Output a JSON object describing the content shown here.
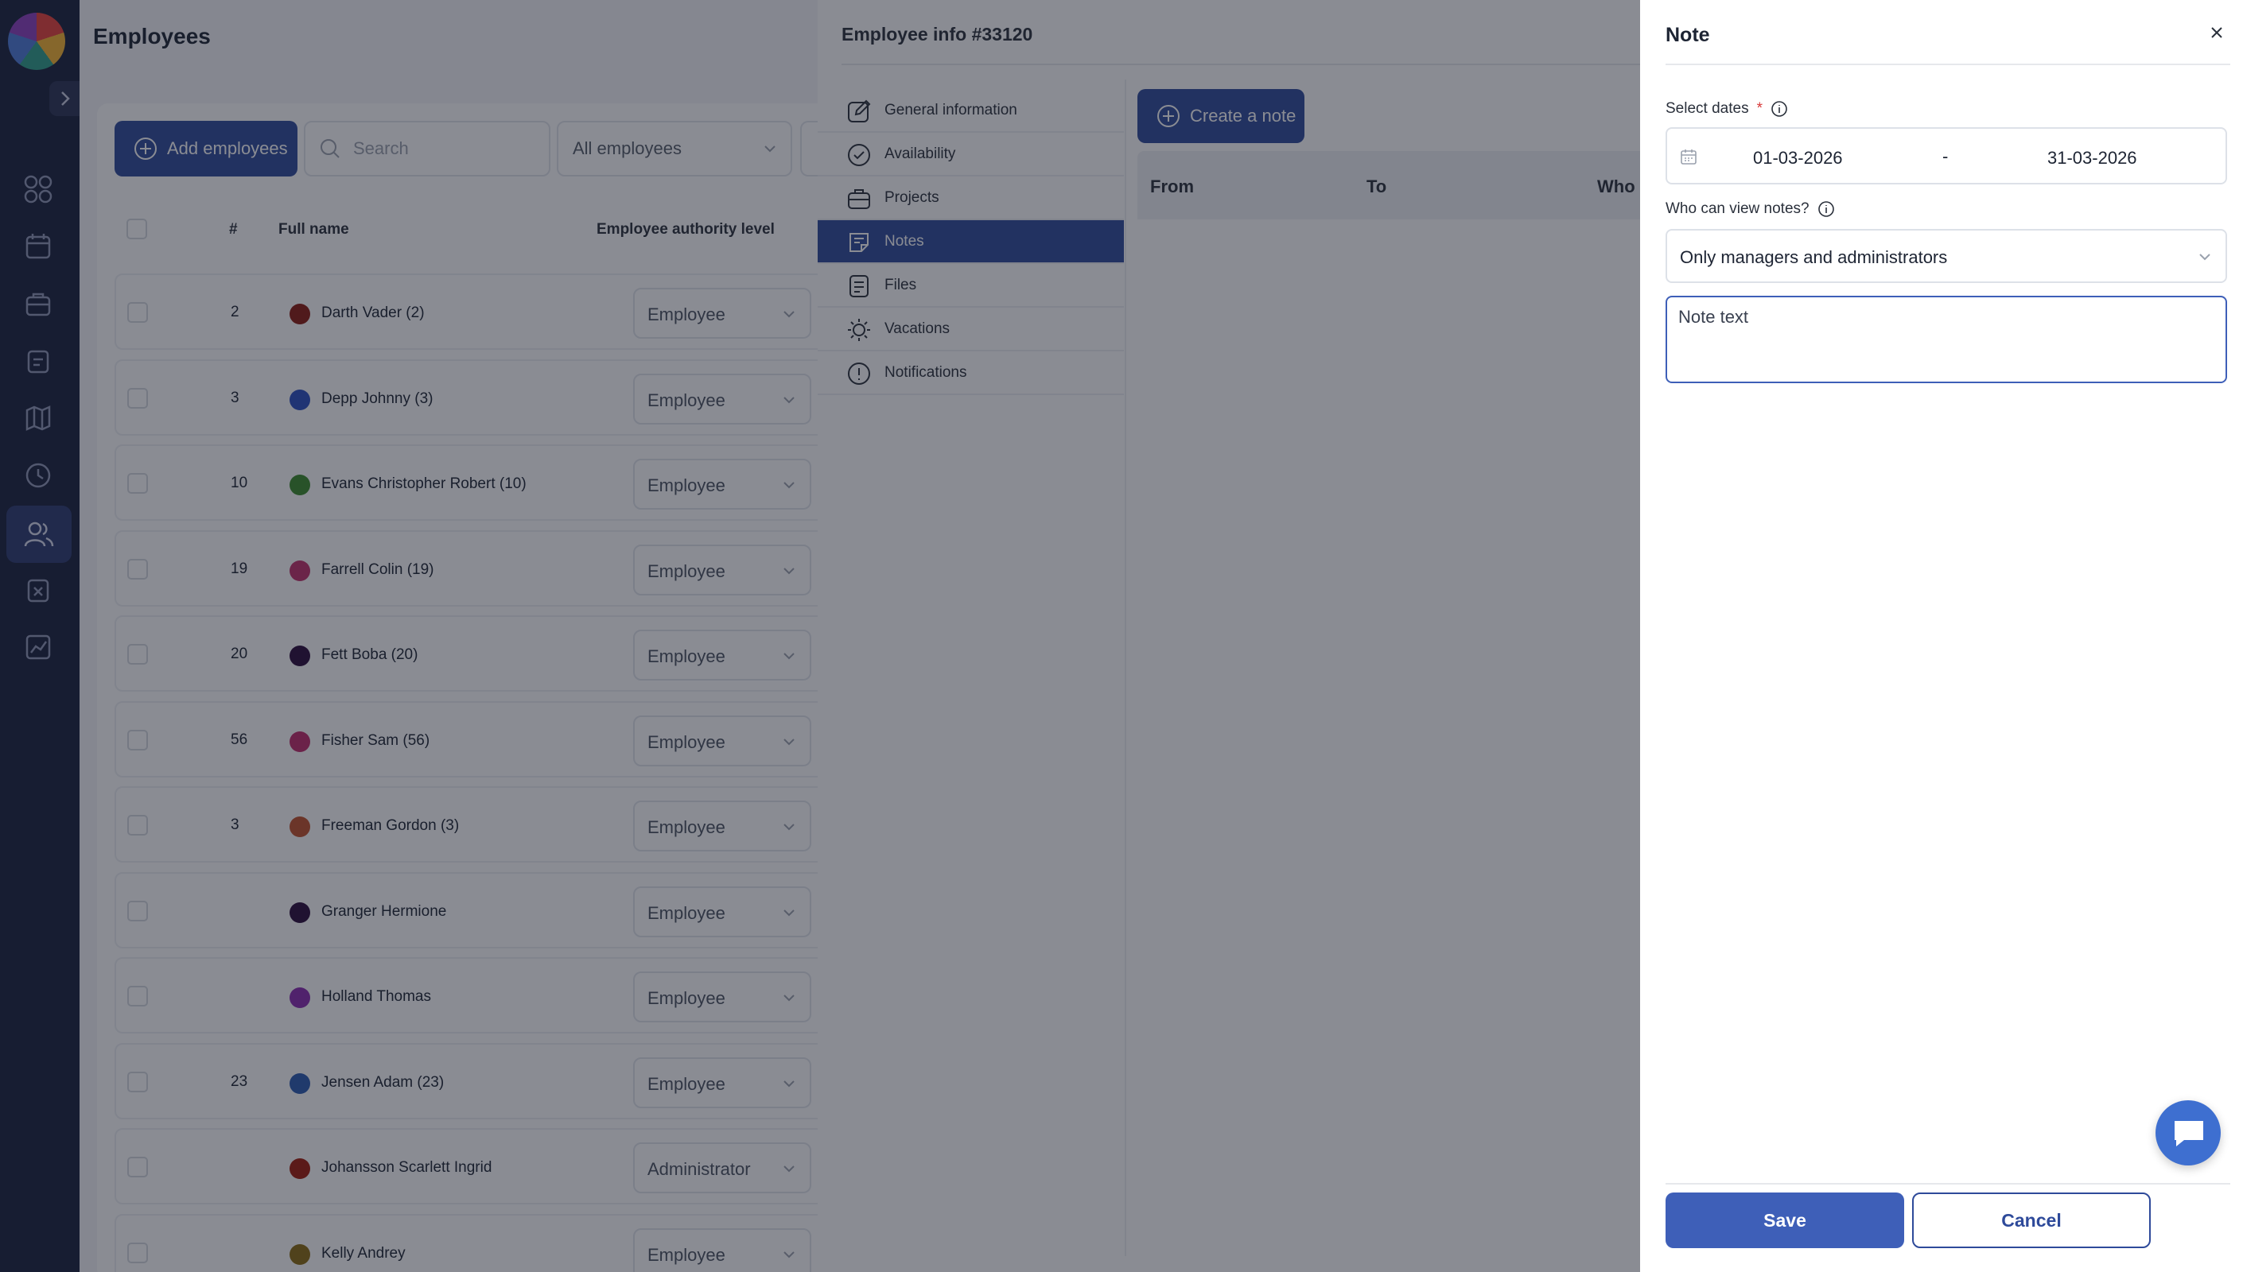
{
  "employees_page": {
    "title": "Employees",
    "add_button": "Add employees",
    "search_placeholder": "Search",
    "filter_value": "All employees",
    "columns": {
      "number": "#",
      "full_name": "Full name",
      "authority": "Employee authority level"
    },
    "rows": [
      {
        "number": "2",
        "name": "Darth Vader (2)",
        "level": "Employee",
        "color": "#8a1a10"
      },
      {
        "number": "3",
        "name": "Depp Johnny (3)",
        "level": "Employee",
        "color": "#2a4fc0"
      },
      {
        "number": "10",
        "name": "Evans Christopher Robert (10)",
        "level": "Employee",
        "color": "#3a8a2a"
      },
      {
        "number": "19",
        "name": "Farrell Colin (19)",
        "level": "Employee",
        "color": "#c0306a"
      },
      {
        "number": "20",
        "name": "Fett Boba (20)",
        "level": "Employee",
        "color": "#2a0a3a"
      },
      {
        "number": "56",
        "name": "Fisher Sam (56)",
        "level": "Employee",
        "color": "#c02a6a"
      },
      {
        "number": "3",
        "name": "Freeman Gordon (3)",
        "level": "Employee",
        "color": "#c0502a"
      },
      {
        "number": "",
        "name": "Granger Hermione",
        "level": "Employee",
        "color": "#2a0a3a"
      },
      {
        "number": "",
        "name": "Holland Thomas",
        "level": "Employee",
        "color": "#8a2ab0"
      },
      {
        "number": "23",
        "name": "Jensen Adam (23)",
        "level": "Employee",
        "color": "#2a5ab0"
      },
      {
        "number": "",
        "name": "Johansson Scarlett Ingrid",
        "level": "Administrator",
        "color": "#a01a0a"
      },
      {
        "number": "",
        "name": "Kelly Andrey",
        "level": "Employee",
        "color": "#8a6a10"
      }
    ]
  },
  "employee_info": {
    "title": "Employee info #33120",
    "menu": [
      {
        "label": "General information",
        "icon": "edit-icon"
      },
      {
        "label": "Availability",
        "icon": "check-circle-icon"
      },
      {
        "label": "Projects",
        "icon": "briefcase-icon"
      },
      {
        "label": "Notes",
        "icon": "note-icon",
        "active": true
      },
      {
        "label": "Files",
        "icon": "file-icon"
      },
      {
        "label": "Vacations",
        "icon": "sun-icon"
      },
      {
        "label": "Notifications",
        "icon": "alert-icon"
      }
    ],
    "create_button": "Create a note",
    "table_headers": [
      "From",
      "To",
      "Who"
    ]
  },
  "note_drawer": {
    "title": "Note",
    "select_dates_label": "Select dates",
    "required_mark": "*",
    "date_from": "01-03-2026",
    "date_separator": "-",
    "date_to": "31-03-2026",
    "visibility_label": "Who can view notes?",
    "visibility_value": "Only managers and administrators",
    "note_placeholder": "Note text",
    "save_button": "Save",
    "cancel_button": "Cancel"
  },
  "colors": {
    "primary": "#2e4a9a",
    "save": "#3e5fb8",
    "rail": "#18203d",
    "required": "#d83a3a"
  }
}
